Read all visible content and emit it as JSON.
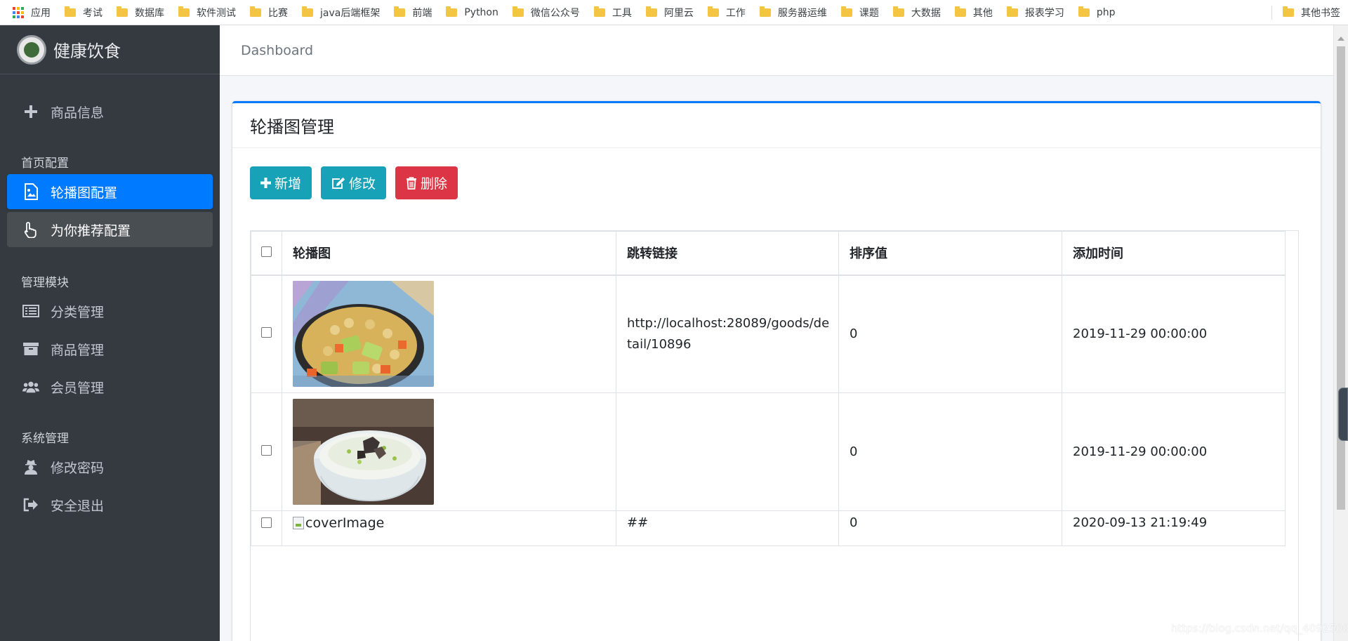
{
  "bookmarks": {
    "apps_label": "应用",
    "items": [
      "考试",
      "数据库",
      "软件测试",
      "比赛",
      "java后端框架",
      "前端",
      "Python",
      "微信公众号",
      "工具",
      "阿里云",
      "工作",
      "服务器运维",
      "课题",
      "大数据",
      "其他",
      "报表学习",
      "php"
    ],
    "other_label": "其他书签"
  },
  "sidebar": {
    "brand": "健康饮食",
    "top_item": "商品信息",
    "section_home": "首页配置",
    "carousel_item": "轮播图配置",
    "recommend_item": "为你推荐配置",
    "section_manage": "管理模块",
    "category_item": "分类管理",
    "goods_item": "商品管理",
    "member_item": "会员管理",
    "section_system": "系统管理",
    "password_item": "修改密码",
    "logout_item": "安全退出"
  },
  "header": {
    "breadcrumb": "Dashboard"
  },
  "card": {
    "title": "轮播图管理",
    "buttons": {
      "add": "新增",
      "edit": "修改",
      "delete": "删除"
    }
  },
  "table": {
    "columns": [
      "轮播图",
      "跳转链接",
      "排序值",
      "添加时间"
    ],
    "rows": [
      {
        "image": "image-salad",
        "link": "http://localhost:28089/goods/detail/10896",
        "sort": "0",
        "time": "2019-11-29 00:00:00"
      },
      {
        "image": "image-porridge",
        "link": "",
        "sort": "0",
        "time": "2019-11-29 00:00:00"
      },
      {
        "image_alt": "coverImage",
        "link": "##",
        "sort": "0",
        "time": "2020-09-13 21:19:49"
      }
    ]
  },
  "watermark": "https://blog.csdn.net/qq_40925004",
  "colors": {
    "sidebar": "#343a40",
    "active": "#007bff",
    "info": "#17a2b8",
    "danger": "#dc3545"
  }
}
